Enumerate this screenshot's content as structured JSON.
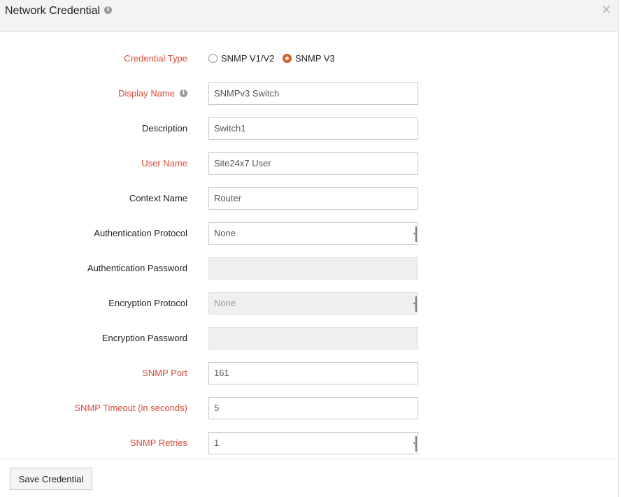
{
  "dialog": {
    "title": "Network Credential",
    "close_icon": "close-icon",
    "info_icon": "info-icon"
  },
  "form": {
    "credential_type": {
      "label": "Credential Type",
      "options": [
        "SNMP V1/V2",
        "SNMP V3"
      ],
      "selected": "SNMP V3"
    },
    "display_name": {
      "label": "Display Name",
      "value": "SNMPv3 Switch"
    },
    "description": {
      "label": "Description",
      "value": "Switch1"
    },
    "user_name": {
      "label": "User Name",
      "value": "Site24x7 User"
    },
    "context_name": {
      "label": "Context Name",
      "value": "Router"
    },
    "auth_protocol": {
      "label": "Authentication Protocol",
      "value": "None"
    },
    "auth_password": {
      "label": "Authentication Password",
      "value": ""
    },
    "enc_protocol": {
      "label": "Encryption Protocol",
      "value": "None"
    },
    "enc_password": {
      "label": "Encryption Password",
      "value": ""
    },
    "snmp_port": {
      "label": "SNMP Port",
      "value": "161"
    },
    "snmp_timeout": {
      "label": "SNMP Timeout (in seconds)",
      "value": "5"
    },
    "snmp_retries": {
      "label": "SNMP Retries",
      "value": "1"
    }
  },
  "footer": {
    "save_label": "Save Credential"
  },
  "colors": {
    "required_label": "#d94a38",
    "radio_accent": "#e0622a",
    "header_bg": "#f3f3f3",
    "disabled_bg": "#efefef"
  }
}
